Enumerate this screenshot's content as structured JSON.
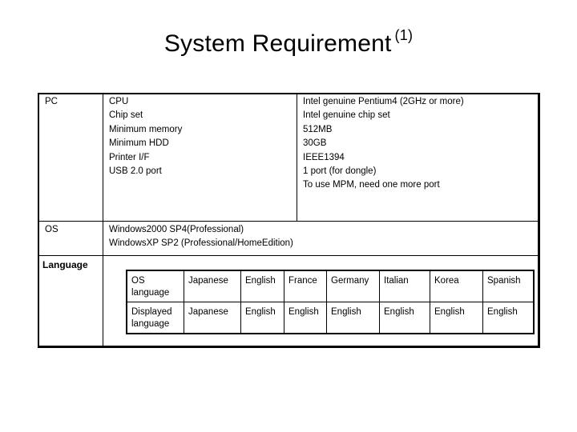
{
  "title": {
    "text": "System Requirement",
    "superscript": "(1)"
  },
  "requirements": {
    "pc": {
      "label": "PC",
      "items": [
        {
          "name": "CPU",
          "value": "Intel genuine  Pentium4 (2GHz or more)"
        },
        {
          "name": "Chip set",
          "value": "Intel genuine chip set"
        },
        {
          "name": "Minimum memory",
          "value": "512MB"
        },
        {
          "name": "Minimum HDD",
          "value": "30GB"
        },
        {
          "name": "Printer I/F",
          "value": "IEEE1394"
        },
        {
          "name": "USB 2.0 port",
          "value": "1 port (for dongle)"
        }
      ],
      "note": "To use MPM, need one more port"
    },
    "os": {
      "label": "OS",
      "lines": [
        "Windows2000  SP4(Professional)",
        "WindowsXP  SP2 (Professional/HomeEdition)"
      ]
    },
    "language": {
      "label": "Language",
      "rows": [
        {
          "header": "OS language",
          "values": [
            "Japanese",
            "English",
            "France",
            "Germany",
            "Italian",
            "Korea",
            "Spanish"
          ]
        },
        {
          "header": "Displayed language",
          "values": [
            "Japanese",
            "English",
            "English",
            "English",
            "English",
            "English",
            "English"
          ]
        }
      ]
    }
  }
}
